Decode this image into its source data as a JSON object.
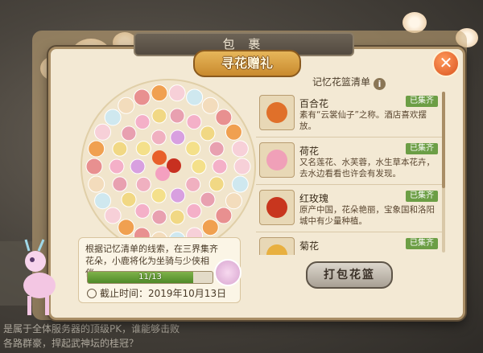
{
  "header": {
    "window_title": "包 裹",
    "banner_title": "寻花赠礼",
    "close_icon": "close-icon"
  },
  "wreath": {
    "flowers_collected": 11,
    "flowers_total": 13
  },
  "info": {
    "description": "根据记忆清单的线索，在三界集齐花朵，小鹿将化为坐骑与少侠相伴。",
    "progress_label": "11/13",
    "progress_fraction": 0.846,
    "deadline": "截止时间：2019年10月13日"
  },
  "list": {
    "header": "记忆花篮清单",
    "info_icon": "i",
    "items": [
      {
        "name": "百合花",
        "desc": "素有“云裳仙子”之称。酒店喜欢摆放。",
        "badge": "已集齐",
        "color": "#e0702a"
      },
      {
        "name": "荷花",
        "desc": "又名莲花、水芙蓉，水生草本花卉，去水边看看也许会有发现。",
        "badge": "已集齐",
        "color": "#f0a0b8"
      },
      {
        "name": "红玫瑰",
        "desc": "原产中国，花朵艳丽，宝象国和洛阳城中有少量种植。",
        "badge": "已集齐",
        "color": "#c8361e"
      },
      {
        "name": "菊花",
        "desc": "",
        "badge": "已集齐",
        "color": "#e8b040"
      }
    ]
  },
  "actions": {
    "pack_button": "打包花篮"
  },
  "background": {
    "chat_text": "是属于全体服务器的顶级PK，谁能够击败各路群豪，捍起武神坛的桂冠？"
  }
}
